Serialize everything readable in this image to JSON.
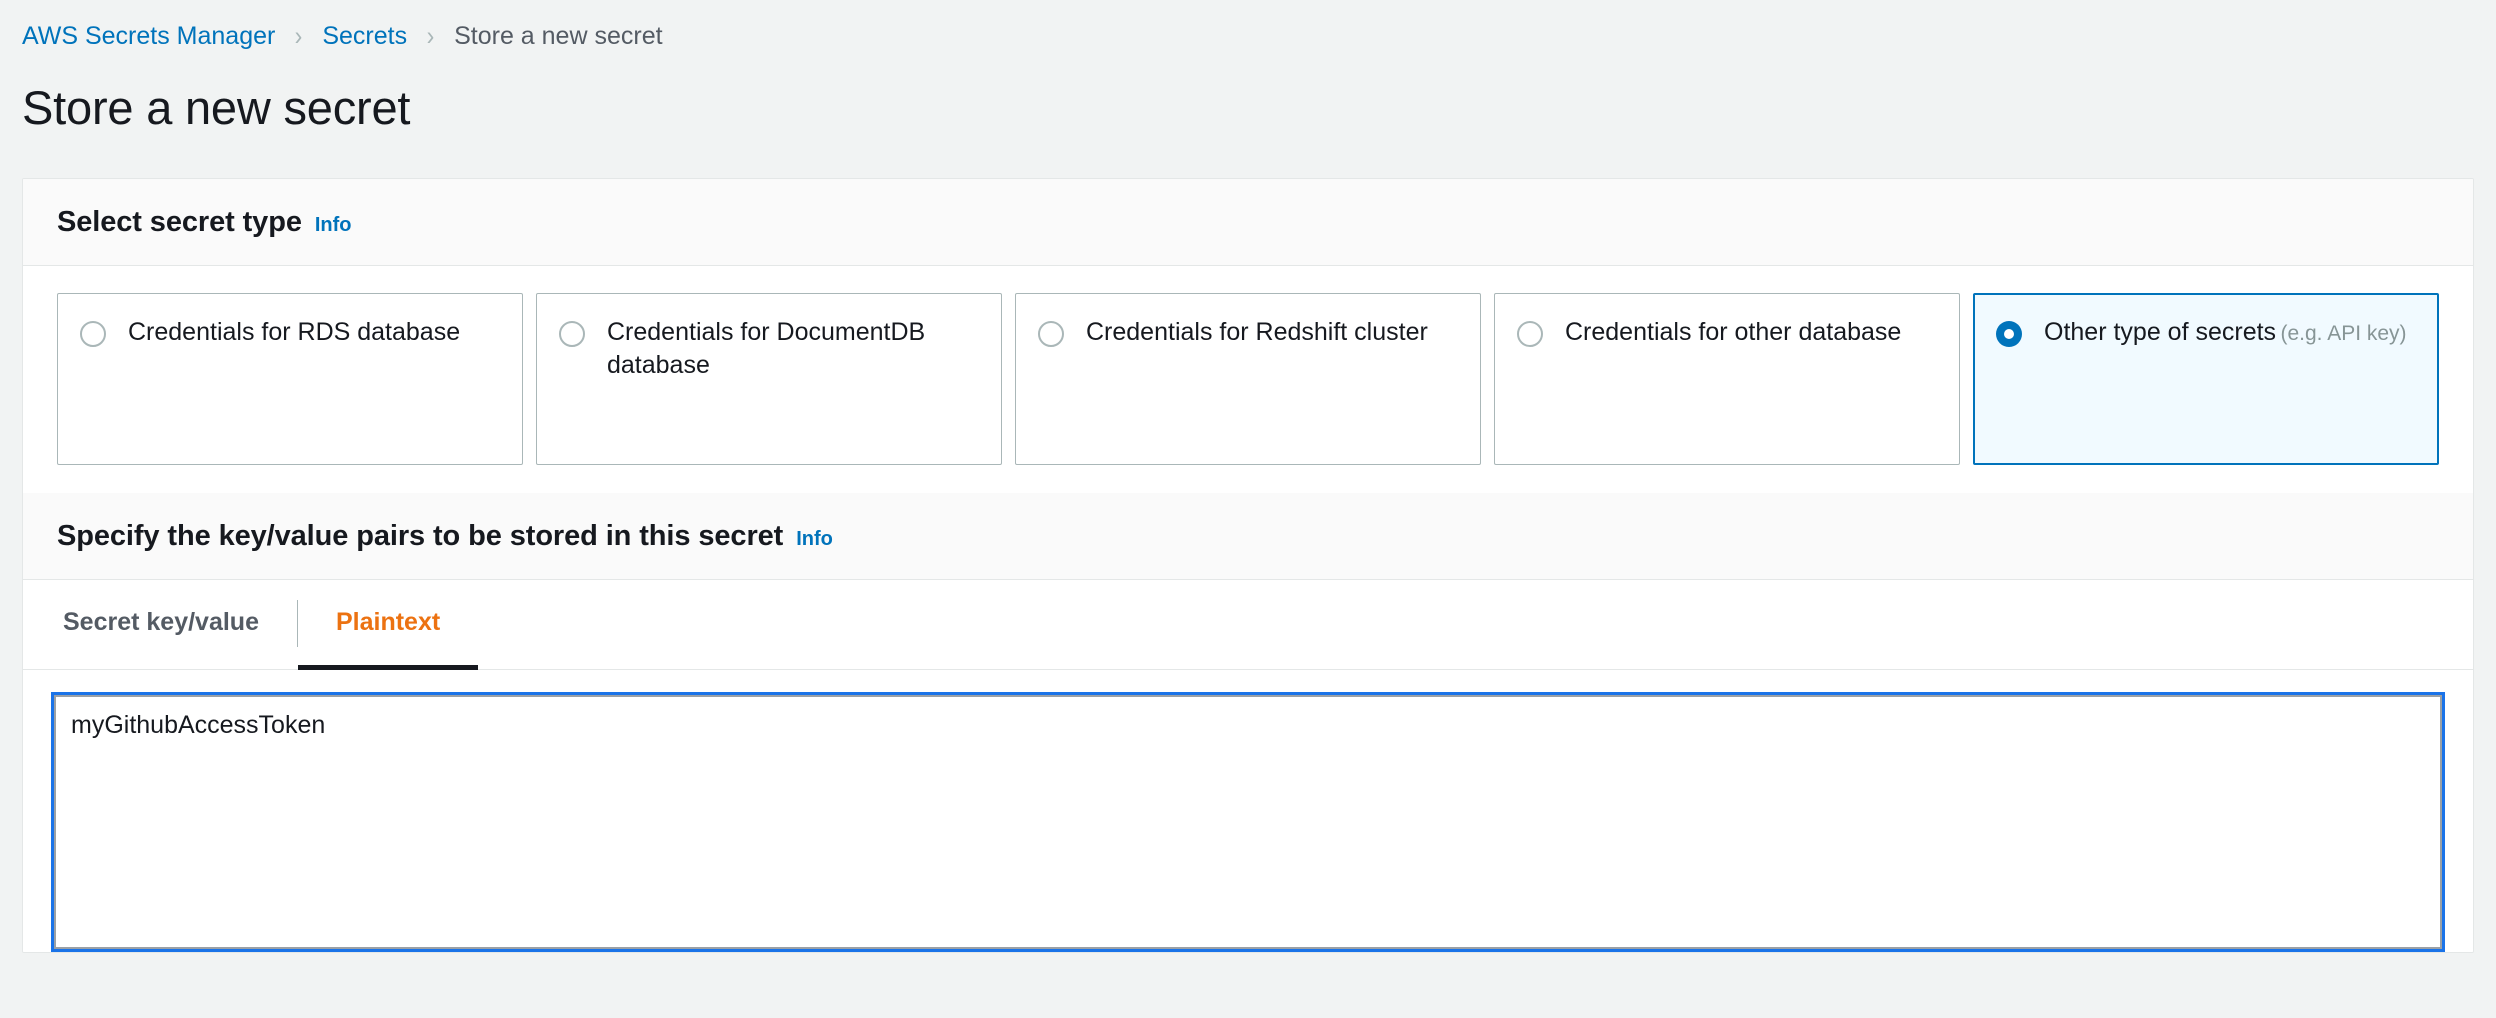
{
  "breadcrumb": {
    "separator": "›",
    "items": [
      {
        "label": "AWS Secrets Manager",
        "current": false
      },
      {
        "label": "Secrets",
        "current": false
      },
      {
        "label": "Store a new secret",
        "current": true
      }
    ]
  },
  "page": {
    "title": "Store a new secret"
  },
  "secret_type_section": {
    "title": "Select secret type",
    "info_label": "Info",
    "options": [
      {
        "label": "Credentials for RDS database",
        "sublabel": "",
        "selected": false
      },
      {
        "label": "Credentials for DocumentDB database",
        "sublabel": "",
        "selected": false
      },
      {
        "label": "Credentials for Redshift cluster",
        "sublabel": "",
        "selected": false
      },
      {
        "label": "Credentials for other database",
        "sublabel": "",
        "selected": false
      },
      {
        "label": "Other type of secrets",
        "sublabel": "(e.g. API key)",
        "selected": true
      }
    ]
  },
  "key_value_section": {
    "title": "Specify the key/value pairs to be stored in this secret",
    "info_label": "Info",
    "tabs": [
      {
        "label": "Secret key/value",
        "active": false
      },
      {
        "label": "Plaintext",
        "active": true
      }
    ],
    "editor": {
      "value": "myGithubAccessToken",
      "placeholder": ""
    }
  },
  "colors": {
    "page_background": "#f1f3f3",
    "link_blue": "#0073bb",
    "accent_orange": "#ec7211",
    "selected_tile_background": "#f1faff",
    "selected_tile_border": "#0073bb",
    "focus_ring_blue": "#1a73e8",
    "text_dark": "#16191f",
    "text_muted": "#545b64",
    "text_subtle": "#879596",
    "border_gray": "#aab7b8",
    "header_band": "#fafafa"
  }
}
